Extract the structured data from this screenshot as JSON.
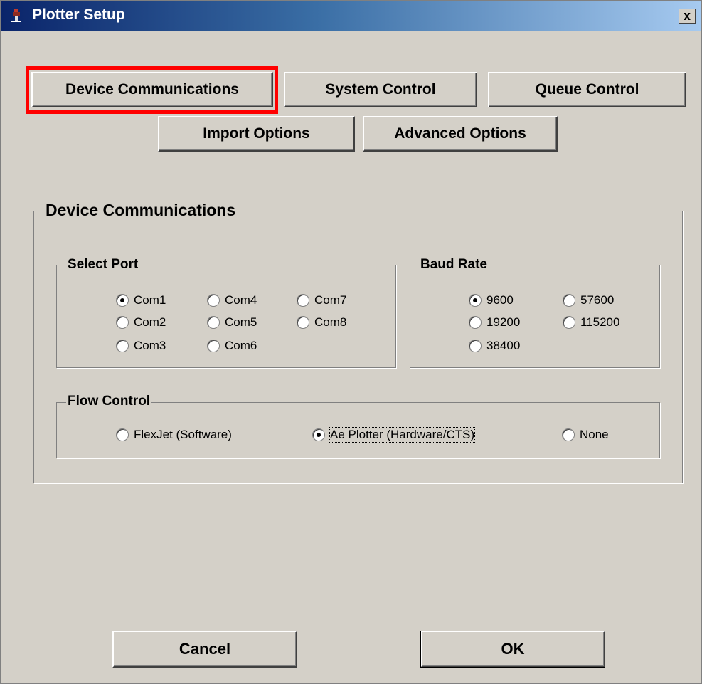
{
  "window": {
    "title": "Plotter Setup",
    "close_glyph": "x"
  },
  "tabs": {
    "device_communications": "Device Communications",
    "system_control": "System Control",
    "queue_control": "Queue Control",
    "import_options": "Import Options",
    "advanced_options": "Advanced Options",
    "active": "Device Communications",
    "highlight_color": "#ff0000"
  },
  "panel": {
    "title": "Device Communications",
    "select_port": {
      "title": "Select Port",
      "options": [
        "Com1",
        "Com2",
        "Com3",
        "Com4",
        "Com5",
        "Com6",
        "Com7",
        "Com8"
      ],
      "selected": "Com1"
    },
    "baud_rate": {
      "title": "Baud Rate",
      "options": [
        "9600",
        "19200",
        "38400",
        "57600",
        "115200"
      ],
      "selected": "9600"
    },
    "flow_control": {
      "title": "Flow Control",
      "options": [
        "FlexJet (Software)",
        "Ae Plotter (Hardware/CTS)",
        "None"
      ],
      "selected": "Ae Plotter (Hardware/CTS)"
    }
  },
  "footer": {
    "cancel_label": "Cancel",
    "ok_label": "OK"
  },
  "icons": {
    "app": "plotter-icon",
    "close": "close-icon"
  }
}
